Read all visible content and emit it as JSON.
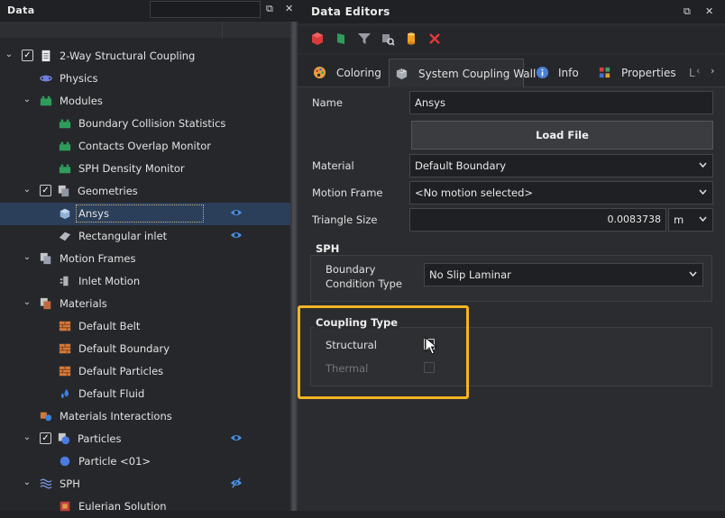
{
  "left_panel": {
    "title": "Data",
    "tree": [
      {
        "label": "2-Way Structural Coupling",
        "icon": "document-icon",
        "checked": true,
        "level": 0
      },
      {
        "label": "Physics",
        "icon": "planet-icon",
        "level": 1
      },
      {
        "label": "Modules",
        "icon": "modules-icon",
        "level": 1
      },
      {
        "label": "Boundary Collision Statistics",
        "icon": "module-icon",
        "level": 2
      },
      {
        "label": "Contacts Overlap Monitor",
        "icon": "module-icon",
        "level": 2
      },
      {
        "label": "SPH Density Monitor",
        "icon": "module-icon",
        "level": 2
      },
      {
        "label": "Geometries",
        "icon": "geometries-icon",
        "checked": true,
        "level": 1
      },
      {
        "label": "Ansys",
        "icon": "geometry-3d-icon",
        "level": 2,
        "selected": true
      },
      {
        "label": "Rectangular inlet",
        "icon": "plane-icon",
        "level": 2
      },
      {
        "label": "Motion Frames",
        "icon": "motion-frames-icon",
        "level": 1
      },
      {
        "label": "Inlet Motion",
        "icon": "motion-icon",
        "level": 2
      },
      {
        "label": "Materials",
        "icon": "materials-icon",
        "level": 1
      },
      {
        "label": "Default Belt",
        "icon": "brick-icon",
        "level": 2
      },
      {
        "label": "Default Boundary",
        "icon": "brick-icon",
        "level": 2
      },
      {
        "label": "Default Particles",
        "icon": "brick-icon",
        "level": 2
      },
      {
        "label": "Default Fluid",
        "icon": "droplets-icon",
        "level": 2
      },
      {
        "label": "Materials Interactions",
        "icon": "interactions-icon",
        "level": 1
      },
      {
        "label": "Particles",
        "icon": "particles-icon",
        "checked": true,
        "level": 1
      },
      {
        "label": "Particle <01>",
        "icon": "sphere-icon",
        "level": 2
      },
      {
        "label": "SPH",
        "icon": "waves-icon",
        "level": 1
      },
      {
        "label": "Eulerian Solution",
        "icon": "eulerian-icon",
        "level": 2
      }
    ]
  },
  "right_panel": {
    "title": "Data Editors",
    "tabs": [
      {
        "label": "Coloring",
        "icon": "palette-icon"
      },
      {
        "label": "System Coupling Wall",
        "icon": "geometry-3d-icon",
        "active": true
      },
      {
        "label": "Info",
        "icon": "info-icon"
      },
      {
        "label": "Properties",
        "icon": "properties-icon"
      },
      {
        "label": "L",
        "icon": ""
      }
    ],
    "form": {
      "name_label": "Name",
      "name_value": "Ansys",
      "load_file_label": "Load File",
      "material_label": "Material",
      "material_value": "Default Boundary",
      "motion_frame_label": "Motion Frame",
      "motion_frame_value": "<No motion selected>",
      "triangle_size_label": "Triangle Size",
      "triangle_size_value": "0.0083738",
      "triangle_size_unit": "m",
      "sph_group_title": "SPH",
      "boundary_condition_label_1": "Boundary",
      "boundary_condition_label_2": "Condition Type",
      "boundary_condition_value": "No Slip Laminar",
      "coupling_group_title": "Coupling Type",
      "structural_label": "Structural",
      "structural_checked": false,
      "thermal_label": "Thermal",
      "thermal_checked": false,
      "thermal_enabled": false
    }
  },
  "colors": {
    "highlight": "#f5b423",
    "accent_blue": "#4a90e2",
    "module_green": "#2e9d5b"
  }
}
